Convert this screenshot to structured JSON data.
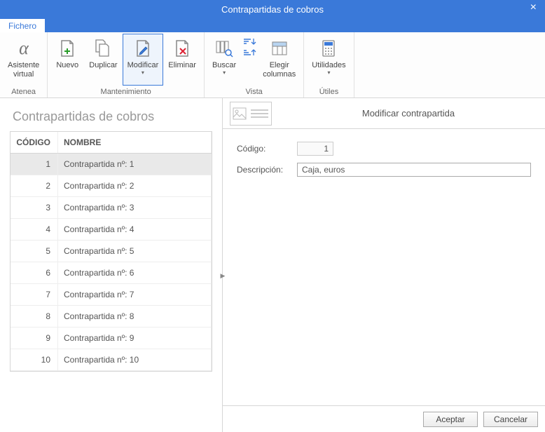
{
  "window": {
    "title": "Contrapartidas de cobros"
  },
  "tab": {
    "label": "Fichero"
  },
  "ribbon": {
    "groups": {
      "atenea": {
        "label": "Atenea",
        "buttons": {
          "asistente": {
            "label": "Asistente\nvirtual"
          }
        }
      },
      "mantenimiento": {
        "label": "Mantenimiento",
        "buttons": {
          "nuevo": {
            "label": "Nuevo"
          },
          "duplicar": {
            "label": "Duplicar"
          },
          "modificar": {
            "label": "Modificar"
          },
          "eliminar": {
            "label": "Eliminar"
          }
        }
      },
      "vista": {
        "label": "Vista",
        "buttons": {
          "buscar": {
            "label": "Buscar"
          },
          "elegir_columnas": {
            "label": "Elegir\ncolumnas"
          }
        }
      },
      "utiles": {
        "label": "Útiles",
        "buttons": {
          "utilidades": {
            "label": "Utilidades"
          }
        }
      }
    }
  },
  "left": {
    "heading": "Contrapartidas de cobros",
    "columns": {
      "code": "CÓDIGO",
      "name": "NOMBRE"
    },
    "rows": [
      {
        "code": "1",
        "name": "Contrapartida nº: 1",
        "selected": true
      },
      {
        "code": "2",
        "name": "Contrapartida nº: 2"
      },
      {
        "code": "3",
        "name": "Contrapartida nº: 3"
      },
      {
        "code": "4",
        "name": "Contrapartida nº: 4"
      },
      {
        "code": "5",
        "name": "Contrapartida nº: 5"
      },
      {
        "code": "6",
        "name": "Contrapartida nº: 6"
      },
      {
        "code": "7",
        "name": "Contrapartida nº: 7"
      },
      {
        "code": "8",
        "name": "Contrapartida nº: 8"
      },
      {
        "code": "9",
        "name": "Contrapartida nº: 9"
      },
      {
        "code": "10",
        "name": "Contrapartida nº: 10"
      }
    ]
  },
  "form": {
    "title": "Modificar contrapartida",
    "labels": {
      "codigo": "Código:",
      "descripcion": "Descripción:"
    },
    "values": {
      "codigo": "1",
      "descripcion": "Caja, euros"
    }
  },
  "footer": {
    "accept": "Aceptar",
    "cancel": "Cancelar"
  }
}
